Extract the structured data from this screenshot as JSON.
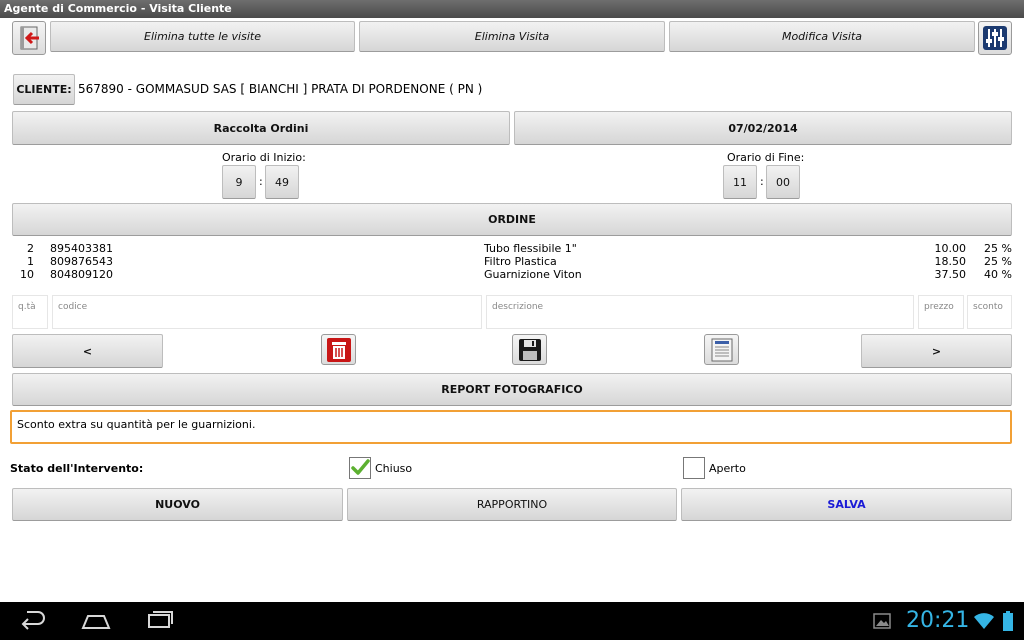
{
  "window": {
    "title": "Agente di Commercio - Visita Cliente"
  },
  "toolbar": {
    "delete_all_label": "Elimina tutte le visite",
    "delete_label": "Elimina Visita",
    "edit_label": "Modifica Visita"
  },
  "client": {
    "button_label": "CLIENTE:",
    "value": "567890 - GOMMASUD SAS [ BIANCHI ] PRATA DI PORDENONE ( PN )"
  },
  "visit": {
    "type_label": "Raccolta Ordini",
    "date_label": "07/02/2014",
    "start_label": "Orario di Inizio:",
    "start_hour": "9",
    "start_minute": "49",
    "end_label": "Orario di Fine:",
    "end_hour": "11",
    "end_minute": "00",
    "time_separator": ":"
  },
  "order": {
    "header": "ORDINE",
    "rows": [
      {
        "qty": "2",
        "code": "895403381",
        "description": "Tubo flessibile 1\"",
        "price": "10.00",
        "discount": "25 %"
      },
      {
        "qty": "1",
        "code": "809876543",
        "description": "Filtro Plastica",
        "price": "18.50",
        "discount": "25 %"
      },
      {
        "qty": "10",
        "code": "804809120",
        "description": "Guarnizione Viton",
        "price": "37.50",
        "discount": "40 %"
      }
    ]
  },
  "fields": {
    "qty_placeholder": "q.tà",
    "code_placeholder": "codice",
    "description_placeholder": "descrizione",
    "price_placeholder": "prezzo",
    "discount_placeholder": "sconto"
  },
  "nav": {
    "prev_label": "<",
    "next_label": ">"
  },
  "report": {
    "label": "REPORT FOTOGRAFICO"
  },
  "notes": {
    "text": "Sconto extra su quantità per le guarnizioni."
  },
  "status": {
    "label": "Stato dell'Intervento:",
    "closed_label": "Chiuso",
    "closed_checked": true,
    "open_label": "Aperto",
    "open_checked": false
  },
  "actions": {
    "new_label": "NUOVO",
    "report_label": "RAPPORTINO",
    "save_label": "SALVA",
    "save_color": "#1a1ad6"
  },
  "system": {
    "clock": "20:21",
    "accent": "#35b5e5"
  },
  "icons": [
    "exit-icon",
    "settings-sliders-icon",
    "trash-icon",
    "floppy-disk-icon",
    "list-document-icon",
    "back-icon",
    "home-icon",
    "recent-apps-icon",
    "gallery-notification-icon",
    "wifi-icon",
    "battery-icon"
  ]
}
